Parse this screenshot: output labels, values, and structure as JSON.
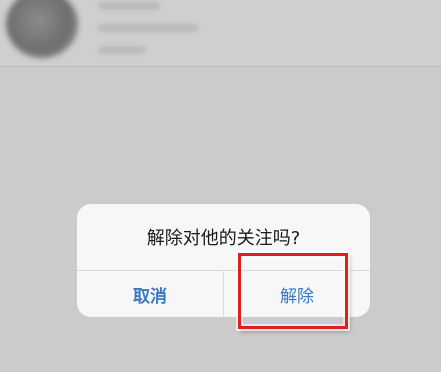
{
  "dialog": {
    "title": "解除对他的关注吗?",
    "cancel_label": "取消",
    "confirm_label": "解除"
  },
  "colors": {
    "button_text": "#3a78c4",
    "highlight": "#e01f1f",
    "overlay": "#cbcbcb"
  }
}
